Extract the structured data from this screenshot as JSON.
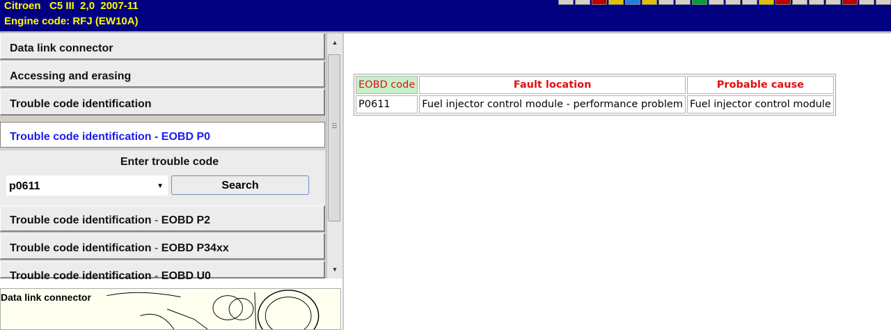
{
  "header": {
    "vehicle_line": "Citroen   C5 III  2,0  2007-11",
    "engine_line": "Engine code: RFJ (EW10A)"
  },
  "menu": {
    "items": [
      {
        "label": "Data link connector"
      },
      {
        "label": "Accessing and erasing"
      },
      {
        "label": "Trouble code identification"
      },
      {
        "label": "Trouble code identification - EOBD P0",
        "active": true
      },
      {
        "label_main": "Trouble code identification",
        "label_sep": " - ",
        "label_suffix": "EOBD P2"
      },
      {
        "label_main": "Trouble code identification",
        "label_sep": " - ",
        "label_suffix": "EOBD P34xx"
      },
      {
        "label_main": "Trouble code identification",
        "label_sep": " - ",
        "label_suffix": "EOBD U0"
      }
    ]
  },
  "entry": {
    "title": "Enter trouble code",
    "code_value": "p0611",
    "search_label": "Search"
  },
  "image_panel": {
    "caption": "Data link connector"
  },
  "results": {
    "headers": [
      "EOBD code",
      "Fault location",
      "Probable cause"
    ],
    "rows": [
      [
        "P0611",
        "Fuel injector control module - performance problem",
        "Fuel injector control module"
      ]
    ]
  },
  "colors": {
    "header_bg": "#000080",
    "header_text": "#ffff00",
    "active_item_text": "#1a1af0",
    "table_header_text": "#e01010"
  }
}
